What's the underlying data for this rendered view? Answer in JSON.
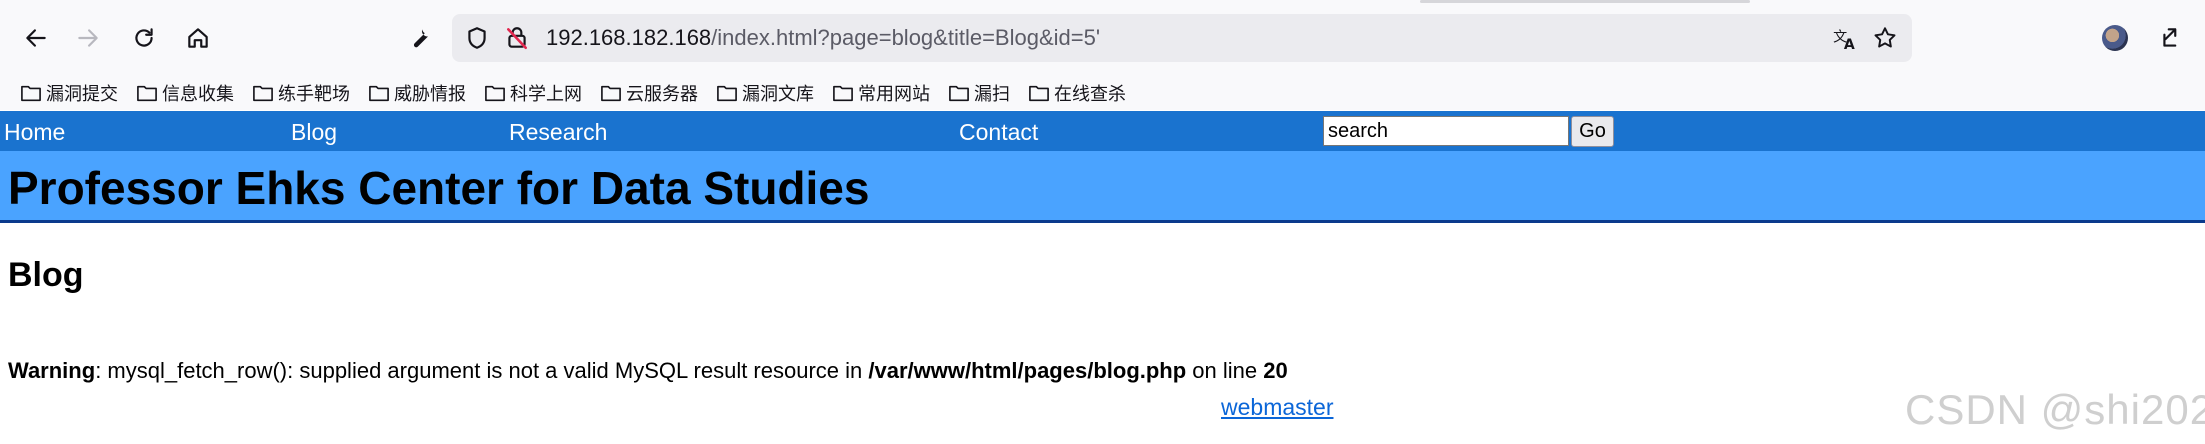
{
  "browser": {
    "url_host": "192.168.182.168",
    "url_path": "/index.html?page=blog&title=Blog&id=5'",
    "bookmarks": [
      "漏洞提交",
      "信息收集",
      "练手靶场",
      "威胁情报",
      "科学上网",
      "云服务器",
      "漏洞文库",
      "常用网站",
      "漏扫",
      "在线查杀"
    ],
    "icons": [
      "back-icon",
      "forward-icon",
      "reload-icon",
      "home-icon",
      "wrench-icon",
      "shield-icon",
      "insecure-lock-icon",
      "translate-icon",
      "star-icon",
      "avatar",
      "extensions-icon",
      "folder-icon"
    ]
  },
  "site": {
    "nav": {
      "home": "Home",
      "blog": "Blog",
      "research": "Research",
      "contact": "Contact"
    },
    "search": {
      "value": "search",
      "button": "Go"
    },
    "title": "Professor Ehks Center for Data Studies",
    "heading": "Blog",
    "warning": {
      "label": "Warning",
      "message": ": mysql_fetch_row(): supplied argument is not a valid MySQL result resource in ",
      "file": "/var/www/html/pages/blog.php",
      "middle": " on line ",
      "line": "20"
    },
    "footer_link": "webmaster"
  },
  "watermark": "CSDN @shi202",
  "colors": {
    "nav_bg": "#1a73cf",
    "header_bg": "#4aa3ff",
    "header_border": "#0b3a8c",
    "link": "#0b66d8"
  }
}
